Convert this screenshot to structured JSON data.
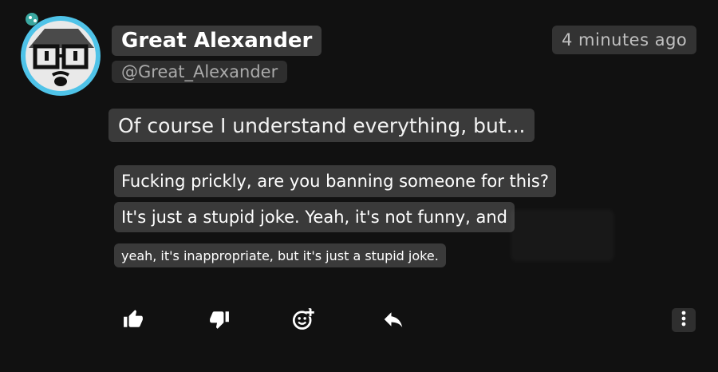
{
  "user": {
    "display_name": "Great Alexander",
    "handle": "@Great_Alexander"
  },
  "timestamp": "4 minutes ago",
  "message": {
    "lines": [
      "Of course I understand everything, but...",
      "Fucking prickly, are you banning someone for this?",
      "It's just a stupid joke. Yeah, it's not funny, and",
      "yeah, it's inappropriate, but it's just a stupid joke."
    ]
  },
  "actions": [
    {
      "icon": "thumbs-up-icon"
    },
    {
      "icon": "thumbs-down-icon"
    },
    {
      "icon": "add-reaction-icon"
    },
    {
      "icon": "reply-icon"
    },
    {
      "icon": "more-vertical-icon"
    }
  ],
  "colors": {
    "background": "#111111",
    "chip": "#3a3a3a",
    "avatar_ring": "#4fc3e8",
    "muted_text": "#aaaaaa"
  }
}
